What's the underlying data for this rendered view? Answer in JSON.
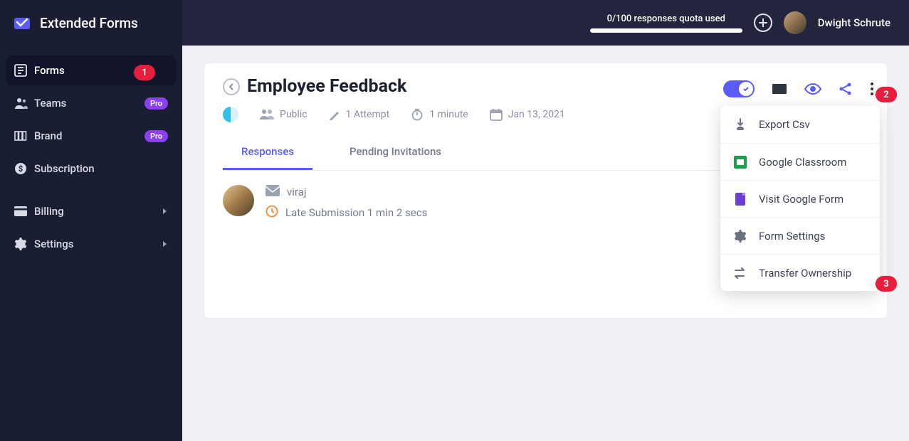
{
  "app": {
    "title": "Extended Forms"
  },
  "sidebar": {
    "items": [
      {
        "label": "Forms"
      },
      {
        "label": "Teams",
        "badge": "Pro"
      },
      {
        "label": "Brand",
        "badge": "Pro"
      },
      {
        "label": "Subscription"
      },
      {
        "label": "Billing"
      },
      {
        "label": "Settings"
      }
    ]
  },
  "topbar": {
    "quota_text": "0/100 responses quota used",
    "user_name": "Dwight Schrute"
  },
  "form": {
    "title": "Employee Feedback",
    "meta": {
      "visibility": "Public",
      "attempts": "1 Attempt",
      "duration": "1 minute",
      "date": "Jan 13, 2021"
    },
    "tabs": [
      {
        "label": "Responses"
      },
      {
        "label": "Pending Invitations"
      }
    ]
  },
  "response": {
    "name": "viraj",
    "late_text": "Late Submission 1 min 2 secs"
  },
  "dropdown": {
    "items": [
      {
        "label": "Export Csv"
      },
      {
        "label": "Google Classroom"
      },
      {
        "label": "Visit Google Form"
      },
      {
        "label": "Form Settings"
      },
      {
        "label": "Transfer Ownership"
      }
    ]
  },
  "annotations": {
    "a1": "1",
    "a2": "2",
    "a3": "3"
  }
}
